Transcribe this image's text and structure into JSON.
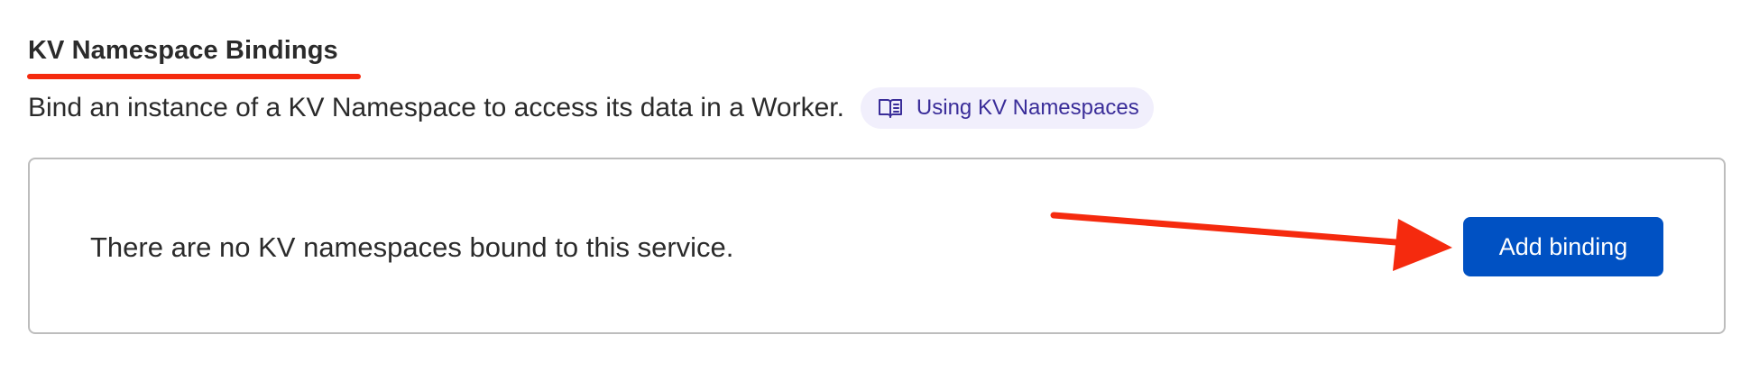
{
  "section": {
    "title": "KV Namespace Bindings",
    "description": "Bind an instance of a KV Namespace to access its data in a Worker.",
    "docs_link": {
      "label": "Using KV Namespaces",
      "icon": "book-icon"
    }
  },
  "panel": {
    "empty_message": "There are no KV namespaces bound to this service.",
    "add_button_label": "Add binding"
  },
  "colors": {
    "annotation": "#f52a0e",
    "button_bg": "#0051c3",
    "pill_bg": "#f1effc",
    "pill_text": "#3a2d99",
    "panel_border": "#bdbdbd",
    "text": "#2b2b2b"
  }
}
